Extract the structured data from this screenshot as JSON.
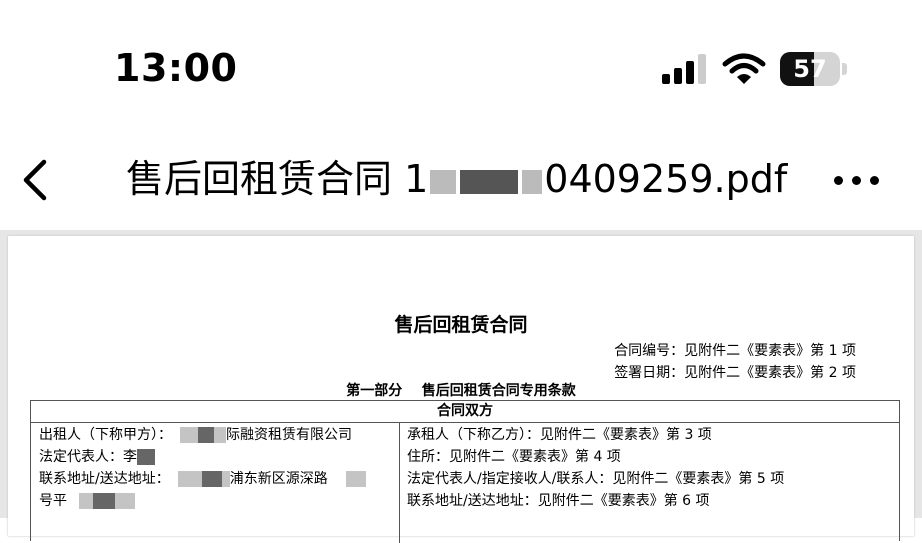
{
  "status_bar": {
    "time": "13:00",
    "battery_level": "57"
  },
  "nav": {
    "title_prefix": "售后回租赁合同 1",
    "title_suffix": "0409259.pdf"
  },
  "document": {
    "title": "售后回租赁合同",
    "contract_no": "合同编号：见附件二《要素表》第 1 项",
    "sign_date": "签署日期：见附件二《要素表》第 2 项",
    "part_heading": "第一部分    售后回租赁合同专用条款",
    "table_header": "合同双方",
    "left": {
      "lessor_prefix": "出租人（下称甲方）：",
      "lessor_suffix": "际融资租赁有限公司",
      "rep_prefix": "法定代表人：李",
      "addr_prefix": "联系地址/送达地址：",
      "addr_suffix": "浦东新区源深路",
      "addr2_prefix": "号平"
    },
    "right": {
      "lessee": "承租人（下称乙方）：见附件二《要素表》第 3 项",
      "residence": "住所：见附件二《要素表》第 4 项",
      "rep": "法定代表人/指定接收人/联系人：见附件二《要素表》第 5 项",
      "address": "联系地址/送达地址：见附件二《要素表》第 6 项"
    }
  }
}
